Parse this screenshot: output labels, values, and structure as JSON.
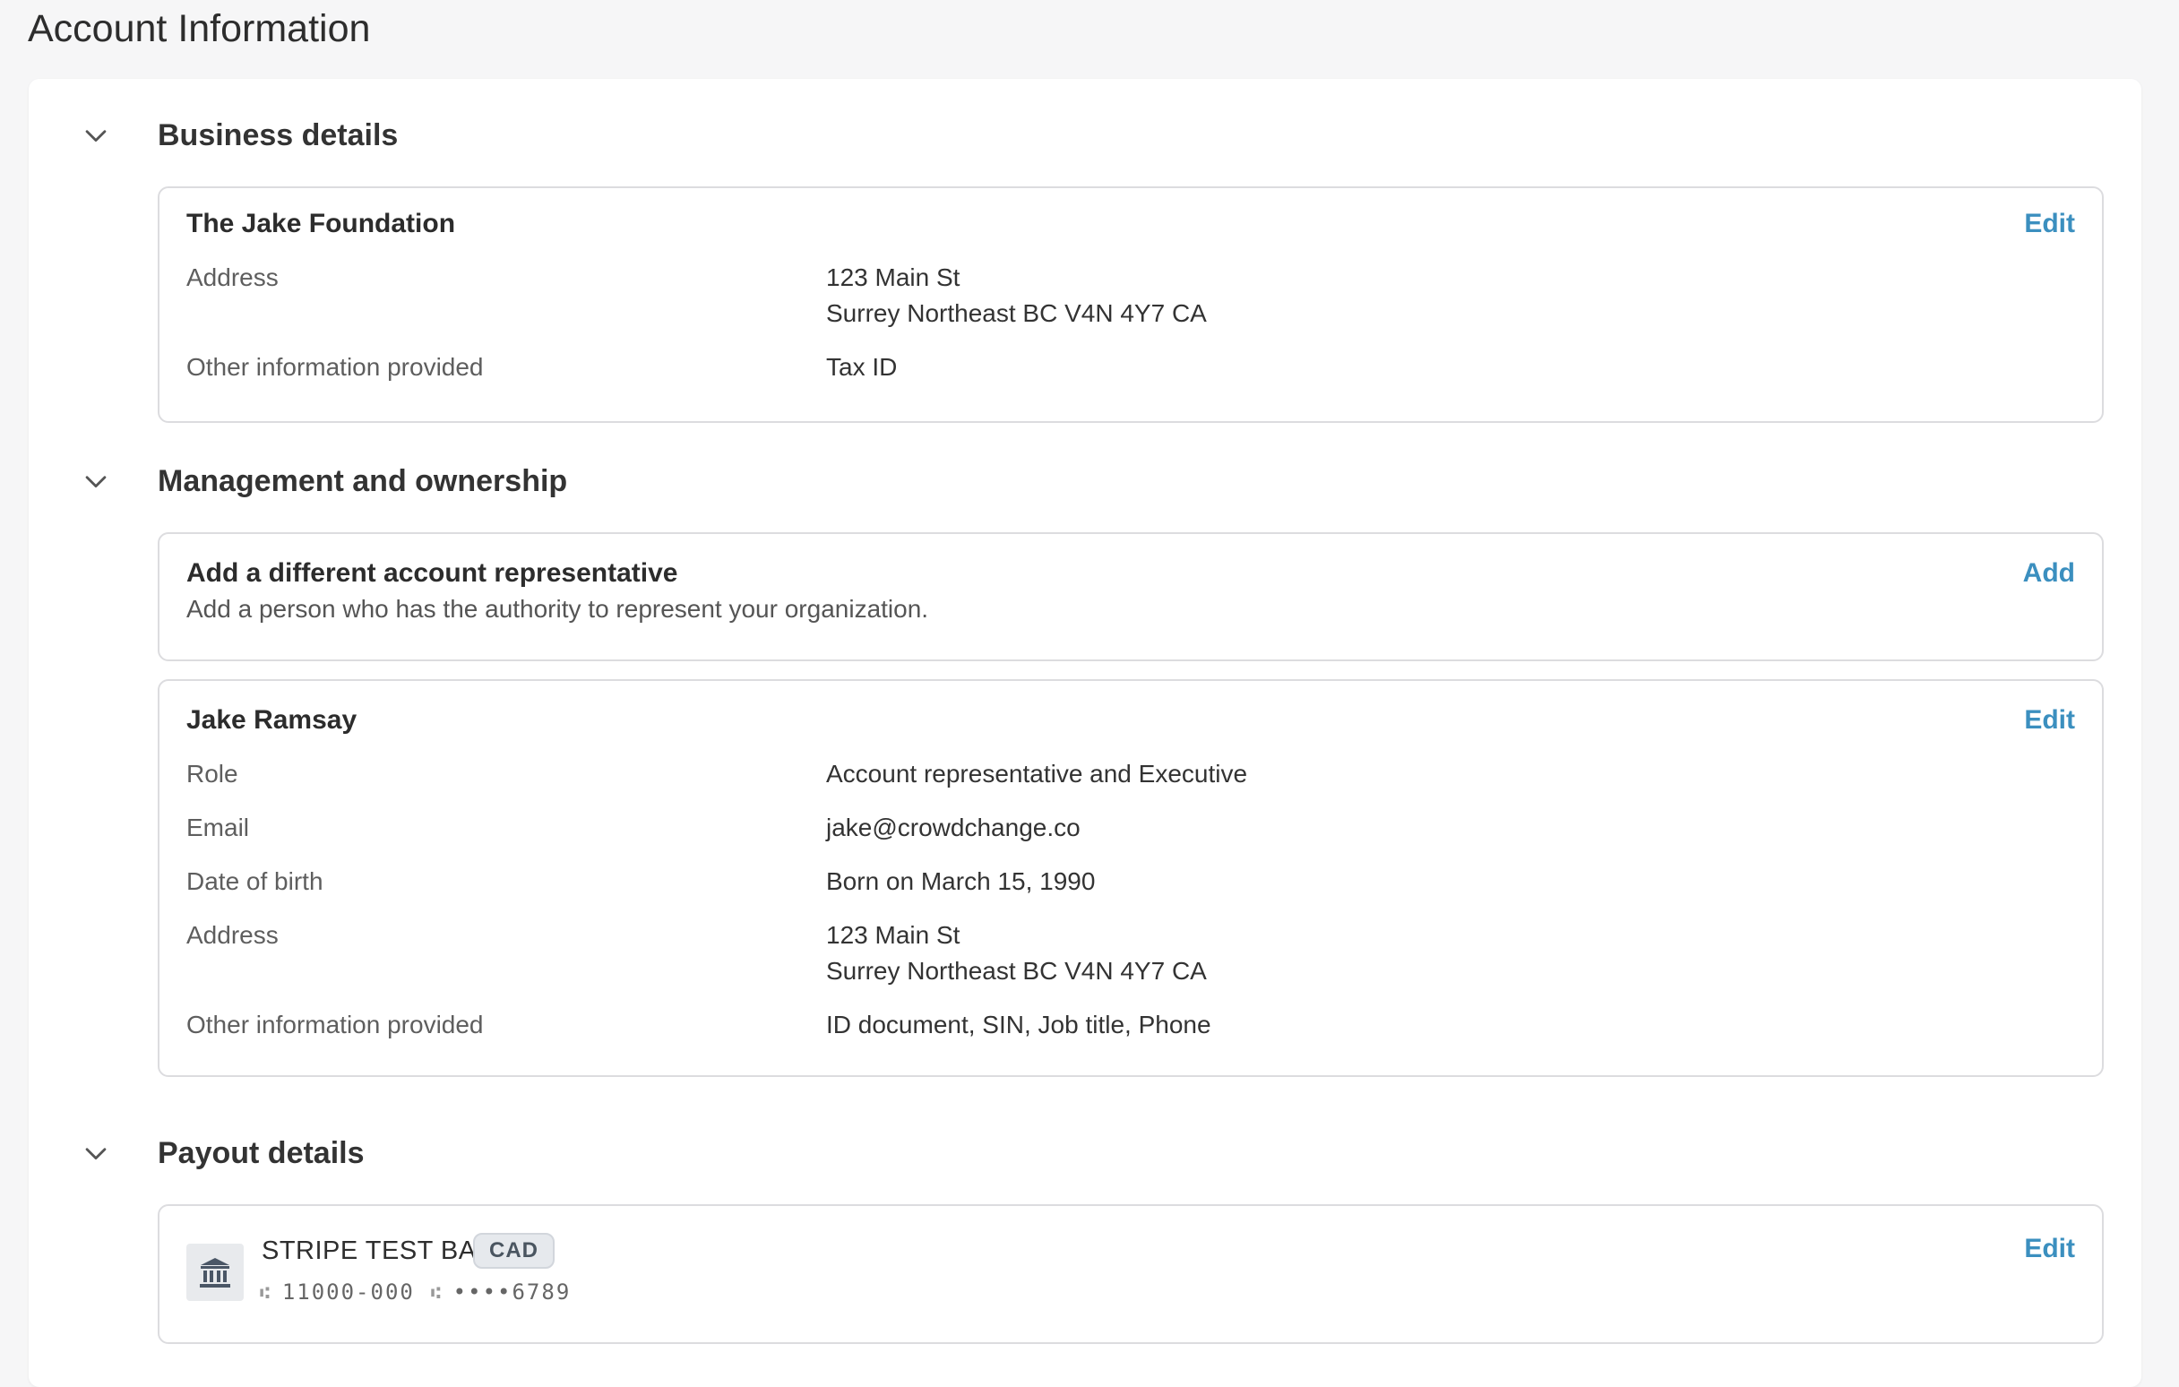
{
  "page": {
    "title": "Account Information"
  },
  "sections": {
    "business": {
      "title": "Business details",
      "card": {
        "name": "The Jake Foundation",
        "action": "Edit",
        "rows": [
          {
            "label": "Address",
            "value_line1": "123 Main St",
            "value_line2": "Surrey Northeast BC V4N 4Y7 CA"
          },
          {
            "label": "Other information provided",
            "value": "Tax ID"
          }
        ]
      }
    },
    "management": {
      "title": "Management and ownership",
      "add_card": {
        "title": "Add a different account representative",
        "subtitle": "Add a person who has the authority to represent your organization.",
        "action": "Add"
      },
      "person_card": {
        "name": "Jake Ramsay",
        "action": "Edit",
        "rows": [
          {
            "label": "Role",
            "value": "Account representative and Executive"
          },
          {
            "label": "Email",
            "value": "jake@crowdchange.co"
          },
          {
            "label": "Date of birth",
            "value": "Born on March 15, 1990"
          },
          {
            "label": "Address",
            "value_line1": "123 Main St",
            "value_line2": "Surrey Northeast BC V4N 4Y7 CA"
          },
          {
            "label": "Other information provided",
            "value": "ID document, SIN, Job title, Phone"
          }
        ]
      }
    },
    "payout": {
      "title": "Payout details",
      "bank_card": {
        "bank_name": "STRIPE TEST BANK",
        "currency": "CAD",
        "routing_icon": "⑆",
        "routing": "11000-000",
        "account_icon": "⑆",
        "account": "••••6789",
        "action": "Edit",
        "icon": "bank-icon"
      }
    }
  },
  "colors": {
    "accent": "#3b8fbf",
    "background": "#f6f6f7",
    "card_border": "#dcdcdf"
  }
}
